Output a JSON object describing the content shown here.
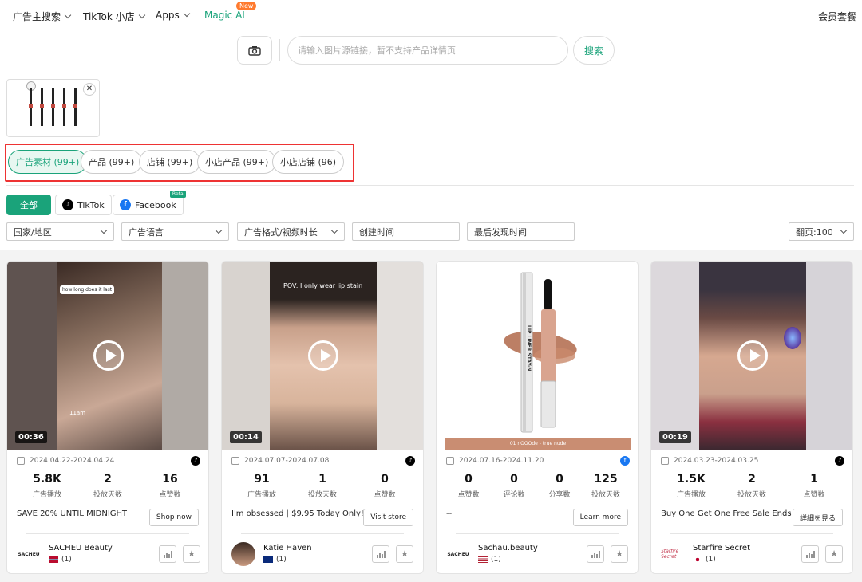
{
  "nav": {
    "items": [
      "广告主搜索",
      "TikTok 小店",
      "Apps",
      "Magic AI"
    ],
    "new_badge": "New",
    "member": "会员套餐"
  },
  "search": {
    "placeholder": "请输入图片源链接，暂不支持产品详情页",
    "button": "搜索"
  },
  "tabs": [
    "广告素材 (99+)",
    "产品 (99+)",
    "店铺 (99+)",
    "小店产品 (99+)",
    "小店店铺 (96)"
  ],
  "platforms": {
    "all": "全部",
    "tiktok": "TikTok",
    "facebook": "Facebook",
    "beta": "Beta"
  },
  "filters": {
    "country": "国家/地区",
    "language": "广告语言",
    "format": "广告格式/视频时长",
    "created": "创建时间",
    "last_seen": "最后发现时间",
    "page_size": "翻页:100"
  },
  "cards": [
    {
      "duration": "00:36",
      "overlay": "how long does it last",
      "caption": "11am",
      "date": "2024.04.22-2024.04.24",
      "platform": "tiktok",
      "stats": [
        {
          "v": "5.8K",
          "l": "广告播放"
        },
        {
          "v": "2",
          "l": "投放天数"
        },
        {
          "v": "16",
          "l": "点赞数"
        }
      ],
      "cta_text": "SAVE 20% UNTIL MIDNIGHT",
      "cta_btn": "Shop now",
      "account": "SACHEU Beauty",
      "count": "(1)",
      "logo": "SACHEU"
    },
    {
      "duration": "00:14",
      "overlay": "POV: I only wear lip stain",
      "caption": "",
      "date": "2024.07.07-2024.07.08",
      "platform": "tiktok",
      "stats": [
        {
          "v": "91",
          "l": "广告播放"
        },
        {
          "v": "1",
          "l": "投放天数"
        },
        {
          "v": "0",
          "l": "点赞数"
        }
      ],
      "cta_text": "I'm obsessed | $9.95 Today Only!",
      "cta_btn": "Visit store",
      "account": "Katie Haven",
      "count": "(1)",
      "logo": ""
    },
    {
      "duration": "",
      "overlay": "",
      "caption": "",
      "date": "2024.07.16-2024.11.20",
      "platform": "facebook",
      "stats": [
        {
          "v": "0",
          "l": "点赞数"
        },
        {
          "v": "0",
          "l": "评论数"
        },
        {
          "v": "0",
          "l": "分享数"
        },
        {
          "v": "125",
          "l": "投放天数"
        }
      ],
      "cta_text": "--",
      "cta_btn": "Learn more",
      "account": "Sachau.beauty",
      "count": "(1)",
      "logo": "SACHEU",
      "product_text": "LIP LINER STAY-N",
      "strip": "01 nOOOde - true nude"
    },
    {
      "duration": "00:19",
      "overlay": "",
      "caption": "",
      "date": "2024.03.23-2024.03.25",
      "platform": "tiktok",
      "stats": [
        {
          "v": "1.5K",
          "l": "广告播放"
        },
        {
          "v": "2",
          "l": "投放天数"
        },
        {
          "v": "1",
          "l": "点赞数"
        }
      ],
      "cta_text": "Buy One Get One Free Sale Ends ...",
      "cta_btn": "詳細を見る",
      "account": "Starfire Secret",
      "count": "(1)",
      "logo": "Starfire Secret"
    }
  ]
}
